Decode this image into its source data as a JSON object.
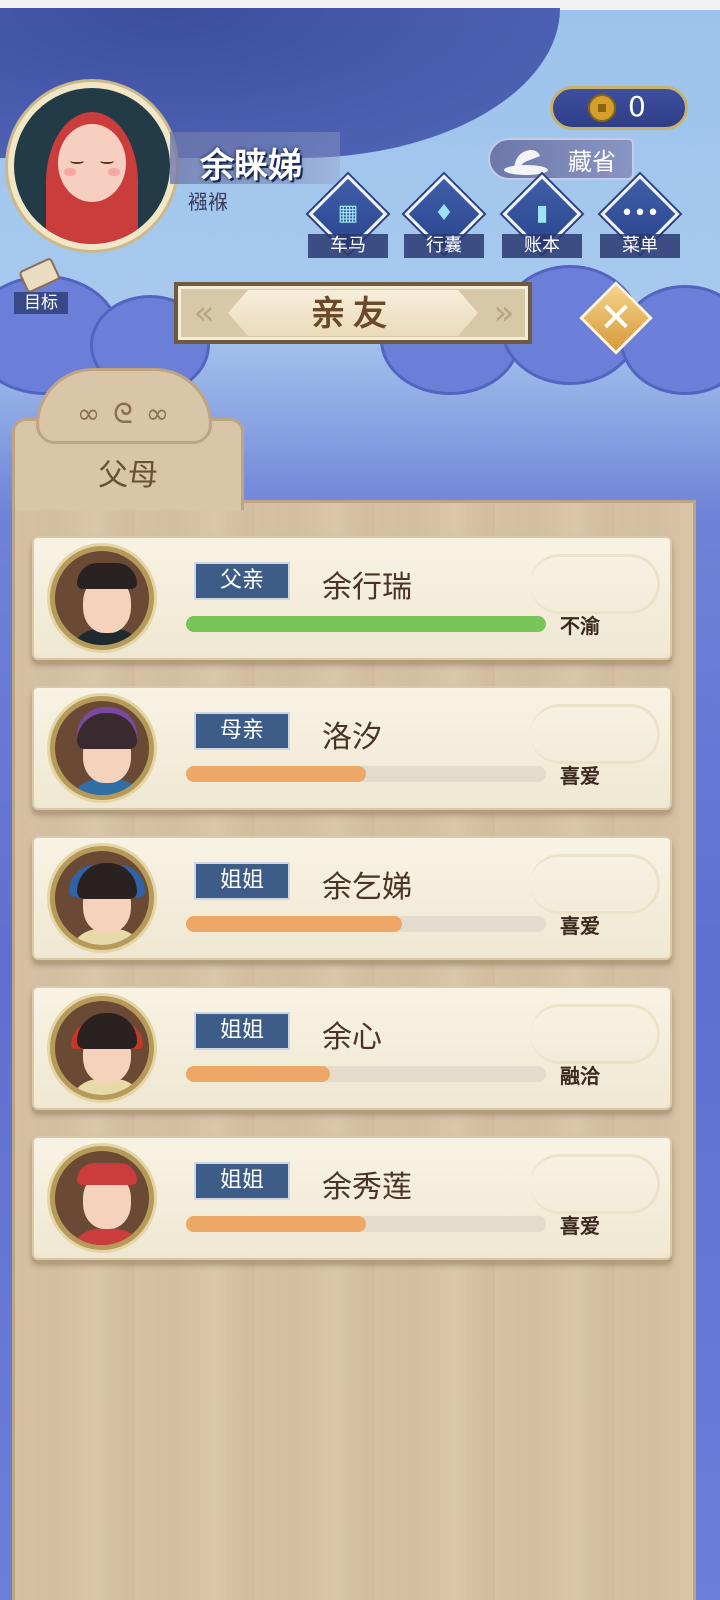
{
  "player": {
    "name": "余睐娣",
    "title": "襁褓"
  },
  "currency": {
    "coins": "0",
    "coin_icon": "copper-coin-icon"
  },
  "toolbar": {
    "hide_label": "藏省",
    "menu": [
      {
        "label": "车马",
        "icon": "carriage-icon"
      },
      {
        "label": "行囊",
        "icon": "bundle-icon"
      },
      {
        "label": "账本",
        "icon": "ledger-icon"
      },
      {
        "label": "菜单",
        "icon": "more-icon"
      }
    ],
    "goal_label": "目标"
  },
  "page": {
    "title": "亲友",
    "tab": "父母"
  },
  "relatives": [
    {
      "role": "父亲",
      "name": "余行瑞",
      "status": "不渝",
      "affinity": 1.0,
      "bar_color": "#7ac55a"
    },
    {
      "role": "母亲",
      "name": "洛汐",
      "status": "喜爱",
      "affinity": 0.5,
      "bar_color": "#eda766"
    },
    {
      "role": "姐姐",
      "name": "余乞娣",
      "status": "喜爱",
      "affinity": 0.6,
      "bar_color": "#eda766"
    },
    {
      "role": "姐姐",
      "name": "余心",
      "status": "融洽",
      "affinity": 0.4,
      "bar_color": "#eda766"
    },
    {
      "role": "姐姐",
      "name": "余秀莲",
      "status": "喜爱",
      "affinity": 0.5,
      "bar_color": "#eda766"
    }
  ],
  "colors": {
    "sky": "#9bc3ec",
    "cloud_dark": "#4a5db0",
    "panel": "#d7c1a5",
    "tag": "#3e5c88"
  }
}
